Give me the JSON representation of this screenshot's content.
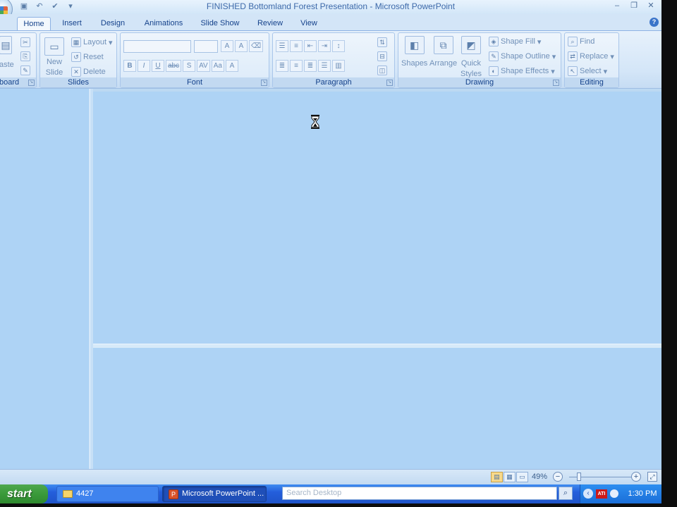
{
  "window": {
    "title_doc": "FINISHED Bottomland Forest Presentation",
    "title_sep": " - ",
    "title_app": "Microsoft PowerPoint"
  },
  "qat": {
    "save_icon": "save-icon",
    "undo_icon": "undo-icon",
    "spell_icon": "spelling-icon",
    "customize_icon": "customize-qat-icon"
  },
  "tabs": [
    {
      "label": "Home",
      "active": true
    },
    {
      "label": "Insert"
    },
    {
      "label": "Design"
    },
    {
      "label": "Animations"
    },
    {
      "label": "Slide Show"
    },
    {
      "label": "Review"
    },
    {
      "label": "View"
    }
  ],
  "ribbon": {
    "clipboard": {
      "label": "board",
      "paste": "aste"
    },
    "slides": {
      "label": "Slides",
      "new_slide_1": "New",
      "new_slide_2": "Slide",
      "layout": "Layout",
      "reset": "Reset",
      "delete": "Delete"
    },
    "font": {
      "label": "Font",
      "grow": "A",
      "shrink": "A",
      "bold": "B",
      "italic": "I",
      "underline": "U",
      "strike": "abc",
      "shadow": "S",
      "spacing": "AV",
      "case": "Aa",
      "color": "A"
    },
    "paragraph": {
      "label": "Paragraph"
    },
    "drawing": {
      "label": "Drawing",
      "shapes": "Shapes",
      "arrange": "Arrange",
      "quick_styles_1": "Quick",
      "quick_styles_2": "Styles",
      "shape_fill": "Shape Fill",
      "shape_outline": "Shape Outline",
      "shape_effects": "Shape Effects"
    },
    "editing": {
      "label": "Editing",
      "find": "Find",
      "replace": "Replace",
      "select": "Select"
    }
  },
  "statusbar": {
    "zoom": "49%",
    "zoom_out": "−",
    "zoom_in": "+"
  },
  "taskbar": {
    "start": "start",
    "tasks": [
      {
        "label": "4427",
        "icon": "folder-icon"
      },
      {
        "label": "Microsoft PowerPoint ...",
        "icon": "powerpoint-icon"
      }
    ],
    "search_placeholder": "Search Desktop",
    "tray_logo": "ATI",
    "clock": "1:30 PM"
  }
}
